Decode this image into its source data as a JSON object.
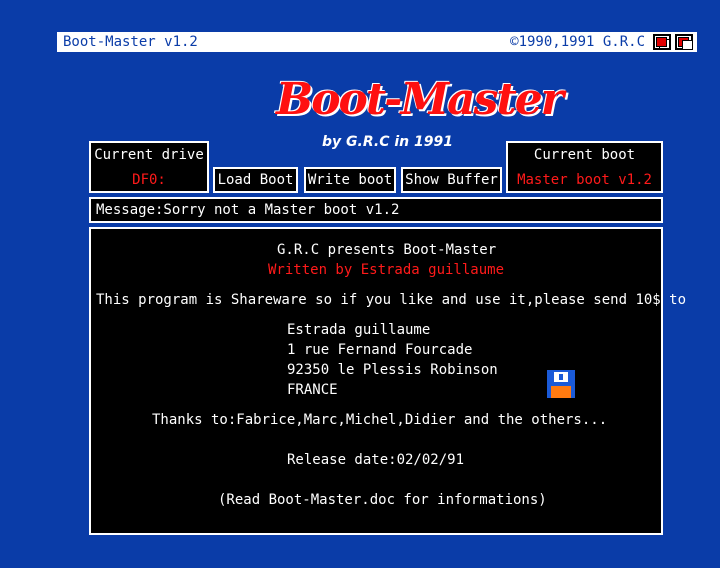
{
  "window": {
    "title": "Boot-Master v1.2",
    "copyright": "©1990,1991 G.R.C"
  },
  "logo": {
    "text": "Boot-Master",
    "byline": "by G.R.C in 1991"
  },
  "drive": {
    "label": "Current drive",
    "value": "DF0:"
  },
  "boot": {
    "label": "Current boot",
    "value": "Master boot v1.2"
  },
  "buttons": {
    "load": "Load Boot",
    "write": "Write boot",
    "show": "Show Buffer"
  },
  "message": "Message:Sorry not a Master boot v1.2",
  "info": {
    "presents": "G.R.C presents Boot-Master",
    "written_by": "Written by Estrada guillaume",
    "shareware": "This program is Shareware so if you like and use it,please send 10$ to",
    "address": [
      "Estrada guillaume",
      "1 rue Fernand Fourcade",
      "92350 le Plessis Robinson",
      "FRANCE"
    ],
    "thanks": "Thanks to:Fabrice,Marc,Michel,Didier and the others...",
    "release": "Release date:02/02/91",
    "readme": "(Read Boot-Master.doc for informations)"
  },
  "colors": {
    "background": "#0a3ca8",
    "accent_red": "#ff1a1a",
    "panel": "#000000"
  },
  "icons": {
    "disk": "floppy-disk-icon",
    "depth": "depth-gadget-icon",
    "zoom": "zoom-gadget-icon"
  }
}
